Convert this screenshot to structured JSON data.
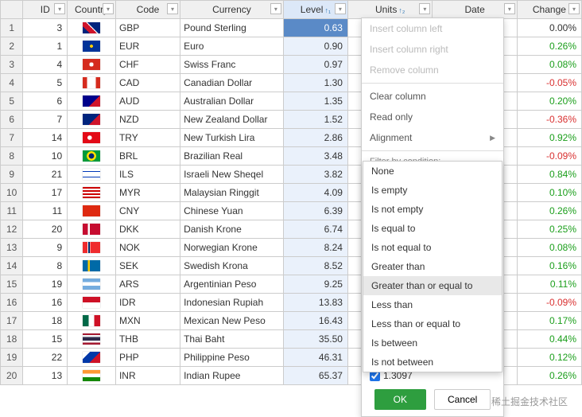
{
  "columns": [
    "ID",
    "Country",
    "Code",
    "Currency",
    "Level",
    "Units",
    "Date",
    "Change"
  ],
  "sort": {
    "level": "↑₁",
    "units": "↑₂"
  },
  "rows": [
    {
      "n": 1,
      "id": 3,
      "flag": "gb",
      "code": "GBP",
      "cur": "Pound Sterling",
      "lvl": "0.63",
      "chg": "0.00%",
      "dir": 0
    },
    {
      "n": 2,
      "id": 1,
      "flag": "eu",
      "code": "EUR",
      "cur": "Euro",
      "lvl": "0.90",
      "chg": "0.26%",
      "dir": 1
    },
    {
      "n": 3,
      "id": 4,
      "flag": "ch",
      "code": "CHF",
      "cur": "Swiss Franc",
      "lvl": "0.97",
      "chg": "0.08%",
      "dir": 1
    },
    {
      "n": 4,
      "id": 5,
      "flag": "ca",
      "code": "CAD",
      "cur": "Canadian Dollar",
      "lvl": "1.30",
      "chg": "-0.05%",
      "dir": -1
    },
    {
      "n": 5,
      "id": 6,
      "flag": "au",
      "code": "AUD",
      "cur": "Australian Dollar",
      "lvl": "1.35",
      "chg": "0.20%",
      "dir": 1
    },
    {
      "n": 6,
      "id": 7,
      "flag": "nz",
      "code": "NZD",
      "cur": "New Zealand Dollar",
      "lvl": "1.52",
      "chg": "-0.36%",
      "dir": -1
    },
    {
      "n": 7,
      "id": 14,
      "flag": "tr",
      "code": "TRY",
      "cur": "New Turkish Lira",
      "lvl": "2.86",
      "chg": "0.92%",
      "dir": 1
    },
    {
      "n": 8,
      "id": 10,
      "flag": "br",
      "code": "BRL",
      "cur": "Brazilian Real",
      "lvl": "3.48",
      "chg": "-0.09%",
      "dir": -1
    },
    {
      "n": 9,
      "id": 21,
      "flag": "il",
      "code": "ILS",
      "cur": "Israeli New Sheqel",
      "lvl": "3.82",
      "chg": "0.84%",
      "dir": 1
    },
    {
      "n": 10,
      "id": 17,
      "flag": "my",
      "code": "MYR",
      "cur": "Malaysian Ringgit",
      "lvl": "4.09",
      "chg": "0.10%",
      "dir": 1
    },
    {
      "n": 11,
      "id": 11,
      "flag": "cn",
      "code": "CNY",
      "cur": "Chinese Yuan",
      "lvl": "6.39",
      "chg": "0.26%",
      "dir": 1
    },
    {
      "n": 12,
      "id": 20,
      "flag": "dk",
      "code": "DKK",
      "cur": "Danish Krone",
      "lvl": "6.74",
      "chg": "0.25%",
      "dir": 1
    },
    {
      "n": 13,
      "id": 9,
      "flag": "no",
      "code": "NOK",
      "cur": "Norwegian Krone",
      "lvl": "8.24",
      "chg": "0.08%",
      "dir": 1
    },
    {
      "n": 14,
      "id": 8,
      "flag": "se",
      "code": "SEK",
      "cur": "Swedish Krona",
      "lvl": "8.52",
      "chg": "0.16%",
      "dir": 1
    },
    {
      "n": 15,
      "id": 19,
      "flag": "ar",
      "code": "ARS",
      "cur": "Argentinian Peso",
      "lvl": "9.25",
      "chg": "0.11%",
      "dir": 1
    },
    {
      "n": 16,
      "id": 16,
      "flag": "id",
      "code": "IDR",
      "cur": "Indonesian Rupiah",
      "lvl": "13.83",
      "chg": "-0.09%",
      "dir": -1
    },
    {
      "n": 17,
      "id": 18,
      "flag": "mx",
      "code": "MXN",
      "cur": "Mexican New Peso",
      "lvl": "16.43",
      "chg": "0.17%",
      "dir": 1
    },
    {
      "n": 18,
      "id": 15,
      "flag": "th",
      "code": "THB",
      "cur": "Thai Baht",
      "lvl": "35.50",
      "chg": "0.44%",
      "dir": 1
    },
    {
      "n": 19,
      "id": 22,
      "flag": "ph",
      "code": "PHP",
      "cur": "Philippine Peso",
      "lvl": "46.31",
      "chg": "0.12%",
      "dir": 1
    },
    {
      "n": 20,
      "id": 13,
      "flag": "in",
      "code": "INR",
      "cur": "Indian Rupee",
      "lvl": "65.37",
      "chg": "0.26%",
      "dir": 1
    }
  ],
  "flags": {
    "gb": "linear-gradient(45deg,#00247d 25%,#cf142b 25%,#cf142b 50%,#fff 50%,#fff 55%,#00247d 55%)",
    "eu": "radial-gradient(circle,#ffcc00 15%,#003399 16%)",
    "ch": "radial-gradient(circle,#fff 20%,#d52b1e 21%)",
    "ca": "linear-gradient(90deg,#d52b1e 25%,#fff 25%,#fff 75%,#d52b1e 75%)",
    "au": "linear-gradient(135deg,#00008b 60%,#cf142b 60%)",
    "nz": "linear-gradient(135deg,#00247d 60%,#cf142b 60%)",
    "tr": "radial-gradient(circle at 40% 50%,#fff 18%,#e30a17 19%)",
    "br": "radial-gradient(circle,#002776 25%,#ffdf00 26%,#ffdf00 45%,#009b3a 46%)",
    "il": "linear-gradient(#fff 20%,#0038b8 20%,#0038b8 30%,#fff 30%,#fff 70%,#0038b8 70%,#0038b8 80%,#fff 80%)",
    "my": "repeating-linear-gradient(#cc0001 0 2px,#fff 2px 4px)",
    "cn": "linear-gradient(#de2910,#de2910)",
    "dk": "linear-gradient(90deg,#c60c30 30%,#fff 30%,#fff 40%,#c60c30 40%)",
    "no": "linear-gradient(90deg,#ef2b2d 28%,#fff 28%,#fff 32%,#002868 32%,#002868 40%,#fff 40%,#fff 44%,#ef2b2d 44%)",
    "se": "linear-gradient(90deg,#006aa7 30%,#fecc00 30%,#fecc00 42%,#006aa7 42%)",
    "ar": "linear-gradient(#74acdf 33%,#fff 33%,#fff 66%,#74acdf 66%)",
    "id": "linear-gradient(#ce1126 50%,#fff 50%)",
    "mx": "linear-gradient(90deg,#006847 33%,#fff 33%,#fff 66%,#ce1126 66%)",
    "th": "linear-gradient(#a51931 16%,#f4f5f8 16%,#f4f5f8 33%,#2d2a4a 33%,#2d2a4a 66%,#f4f5f8 66%,#f4f5f8 83%,#a51931 83%)",
    "ph": "linear-gradient(135deg,#fff 25%,#0038a8 25%,#0038a8 62%,#ce1126 62%)",
    "in": "linear-gradient(#ff9933 33%,#fff 33%,#fff 66%,#138808 66%)"
  },
  "menu": {
    "insert_left": "Insert column left",
    "insert_right": "Insert column right",
    "remove": "Remove column",
    "clear": "Clear column",
    "readonly": "Read only",
    "alignment": "Alignment",
    "filter_label": "Filter by condition:"
  },
  "conditions": [
    "None",
    "Is empty",
    "Is not empty",
    "Is equal to",
    "Is not equal to",
    "Greater than",
    "Greater than or equal to",
    "Less than",
    "Less than or equal to",
    "Is between",
    "Is not between"
  ],
  "condition_value": "1.3097",
  "buttons": {
    "ok": "OK",
    "cancel": "Cancel"
  },
  "watermark": "稀土掘金技术社区"
}
